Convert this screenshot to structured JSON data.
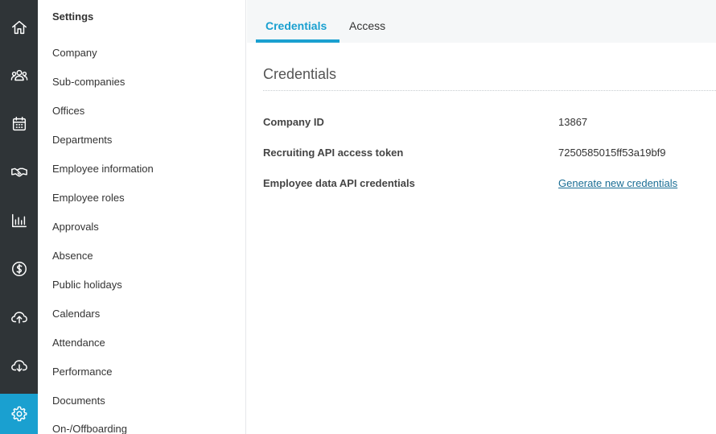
{
  "colors": {
    "rail_bg": "#2f3437",
    "accent": "#1aa0d0",
    "link": "#1b6e95"
  },
  "rail": {
    "items": [
      {
        "icon": "home-icon"
      },
      {
        "icon": "people-icon"
      },
      {
        "icon": "calendar-icon"
      },
      {
        "icon": "handshake-icon"
      },
      {
        "icon": "bar-chart-icon"
      },
      {
        "icon": "dollar-icon"
      },
      {
        "icon": "cloud-upload-icon"
      },
      {
        "icon": "cloud-download-icon"
      },
      {
        "icon": "gear-icon",
        "active": true
      }
    ]
  },
  "sidebar": {
    "title": "Settings",
    "items": [
      {
        "label": "Company"
      },
      {
        "label": "Sub-companies"
      },
      {
        "label": "Offices"
      },
      {
        "label": "Departments"
      },
      {
        "label": "Employee information"
      },
      {
        "label": "Employee roles"
      },
      {
        "label": "Approvals"
      },
      {
        "label": "Absence"
      },
      {
        "label": "Public holidays"
      },
      {
        "label": "Calendars"
      },
      {
        "label": "Attendance"
      },
      {
        "label": "Performance"
      },
      {
        "label": "Documents"
      },
      {
        "label": "On-/Offboarding"
      }
    ]
  },
  "tabs": [
    {
      "label": "Credentials",
      "active": true
    },
    {
      "label": "Access",
      "active": false
    }
  ],
  "section": {
    "title": "Credentials",
    "rows": [
      {
        "label": "Company ID",
        "value": "13867"
      },
      {
        "label": "Recruiting API access token",
        "value": "7250585015ff53a19bf9"
      },
      {
        "label": "Employee data API credentials",
        "value": "Generate new credentials"
      }
    ]
  }
}
